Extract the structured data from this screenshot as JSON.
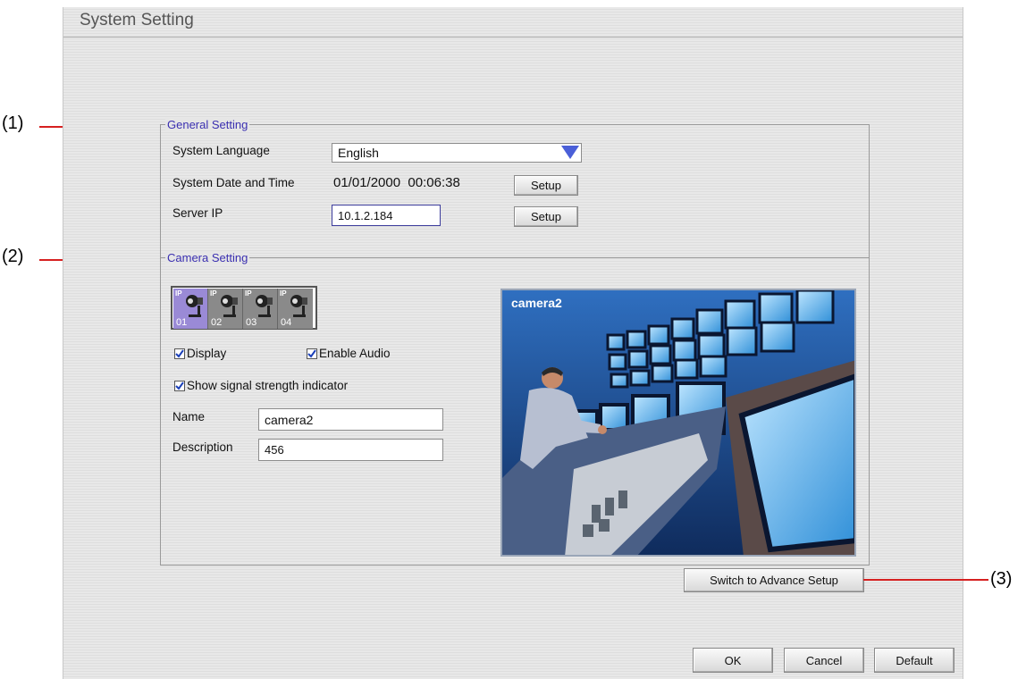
{
  "window": {
    "title": "System Setting"
  },
  "callouts": [
    "(1)",
    "(2)",
    "(3)"
  ],
  "general_setting": {
    "group_title": "General Setting",
    "language_label": "System Language",
    "language_value": "English",
    "datetime_label": "System Date and Time",
    "datetime_value": "01/01/2000  00:06:38",
    "datetime_setup": "Setup",
    "server_ip_label": "Server IP",
    "server_ip_value": "10.1.2.184",
    "server_ip_setup": "Setup"
  },
  "camera_setting": {
    "group_title": "Camera Setting",
    "cameras": [
      {
        "badge": "IP",
        "number": "01",
        "selected": true
      },
      {
        "badge": "IP",
        "number": "02",
        "selected": false
      },
      {
        "badge": "IP",
        "number": "03",
        "selected": false
      },
      {
        "badge": "IP",
        "number": "04",
        "selected": false
      }
    ],
    "display_label": "Display",
    "display_checked": true,
    "enable_audio_label": "Enable Audio",
    "enable_audio_checked": true,
    "signal_label": "Show signal strength indicator",
    "signal_checked": true,
    "name_label": "Name",
    "name_value": "camera2",
    "description_label": "Description",
    "description_value": "456",
    "preview_caption": "camera2"
  },
  "advance_button": "Switch to Advance Setup",
  "footer": {
    "ok": "OK",
    "cancel": "Cancel",
    "default": "Default"
  },
  "colors": {
    "accent_title": "#3a2fb0",
    "callout_line": "#d62020"
  }
}
